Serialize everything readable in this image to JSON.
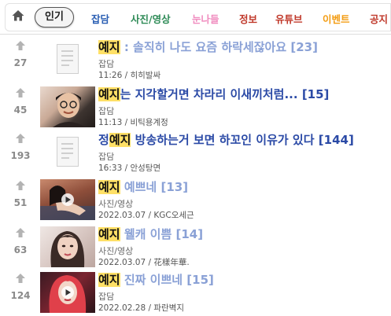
{
  "nav": {
    "home_icon": "home-icon",
    "active": "인기",
    "tabs": [
      {
        "label": "잡담",
        "color": "#2b5fb3"
      },
      {
        "label": "사진/영상",
        "color": "#2e8b57"
      },
      {
        "label": "눈나들",
        "color": "#f08cbf"
      },
      {
        "label": "정보",
        "color": "#c0392b"
      },
      {
        "label": "유튜브",
        "color": "#c0392b"
      },
      {
        "label": "이벤트",
        "color": "#f39c12"
      },
      {
        "label": "공지",
        "color": "#c0392b"
      }
    ]
  },
  "posts": [
    {
      "votes": "27",
      "thumb": "document-icon",
      "title_prefix": "",
      "highlight": "예지",
      "title": " : 솔직히 나도 요즘 하락세잖아요",
      "comments": "[23]",
      "read": true,
      "category": "잡담",
      "time": "11:26",
      "author": "히히발싸"
    },
    {
      "votes": "45",
      "thumb": "photo",
      "title_prefix": "",
      "highlight": "예지",
      "title": "는 지각할거면 차라리 이새끼처럼...",
      "comments": "[15]",
      "read": false,
      "category": "잡담",
      "time": "11:13",
      "author": "비틱용계정"
    },
    {
      "votes": "193",
      "thumb": "document-icon",
      "title_prefix": "정",
      "highlight": "예지",
      "title": " 방송하는거 보면 하꼬인 이유가 있다",
      "comments": "[144]",
      "read": false,
      "category": "잡담",
      "time": "16:33",
      "author": "안성탕면"
    },
    {
      "votes": "51",
      "thumb": "video",
      "title_prefix": "",
      "highlight": "예지",
      "title": " 예쁘네",
      "comments": "[13]",
      "read": true,
      "category": "사진/영상",
      "time": "2022.03.07",
      "author": "KGC오세근"
    },
    {
      "votes": "63",
      "thumb": "photo",
      "title_prefix": "",
      "highlight": "예지",
      "title": " 웰캐 이쁨",
      "comments": "[14]",
      "read": true,
      "category": "사진/영상",
      "time": "2022.03.07",
      "author": "花樣年華."
    },
    {
      "votes": "124",
      "thumb": "video",
      "title_prefix": "",
      "highlight": "예지",
      "title": " 진짜 이쁘네",
      "comments": "[15]",
      "read": true,
      "category": "잡담",
      "time": "2022.02.28",
      "author": "파란벽지"
    }
  ]
}
